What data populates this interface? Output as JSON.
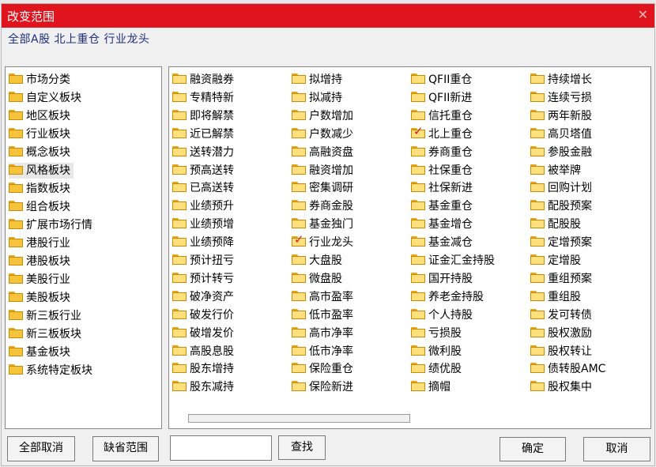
{
  "window": {
    "title": "改变范围",
    "close_symbol": "✕"
  },
  "current_scope": "全部A股 北上重仓 行业龙头",
  "left_list": [
    "市场分类",
    "自定义板块",
    "地区板块",
    "行业板块",
    "概念板块",
    "风格板块",
    "指数板块",
    "组合板块",
    "扩展市场行情",
    "港股行业",
    "港股板块",
    "美股行业",
    "美股板块",
    "新三板行业",
    "新三板板块",
    "基金板块",
    "系统特定板块"
  ],
  "selected_left": "风格板块",
  "grid_columns": [
    [
      "融资融券",
      "专精特新",
      "即将解禁",
      "近已解禁",
      "送转潜力",
      "预高送转",
      "已高送转",
      "业绩预升",
      "业绩预增",
      "业绩预降",
      "预计扭亏",
      "预计转亏",
      "破净资产",
      "破发行价",
      "破增发价",
      "高股息股",
      "股东增持",
      "股东减持"
    ],
    [
      "拟增持",
      "拟减持",
      "户数增加",
      "户数减少",
      "高融资盘",
      "融资增加",
      "密集调研",
      "券商金股",
      "基金独门",
      "行业龙头",
      "大盘股",
      "微盘股",
      "高市盈率",
      "低市盈率",
      "高市净率",
      "低市净率",
      "保险重仓",
      "保险新进"
    ],
    [
      "QFII重仓",
      "QFII新进",
      "信托重仓",
      "北上重仓",
      "券商重仓",
      "社保重仓",
      "社保新进",
      "基金重仓",
      "基金增仓",
      "基金减仓",
      "证金汇金持股",
      "国开持股",
      "养老金持股",
      "个人持股",
      "亏损股",
      "微利股",
      "绩优股",
      "摘帽"
    ],
    [
      "持续增长",
      "连续亏损",
      "两年新股",
      "高贝塔值",
      "参股金融",
      "被举牌",
      "回购计划",
      "配股预案",
      "配股股",
      "定增预案",
      "定增股",
      "重组预案",
      "重组股",
      "发可转债",
      "股权激励",
      "股权转让",
      "债转股AMC",
      "股权集中"
    ]
  ],
  "checked_items": [
    "北上重仓",
    "行业龙头"
  ],
  "buttons": {
    "cancel_all": "全部取消",
    "default_scope": "缺省范围",
    "find": "查找",
    "ok": "确定",
    "cancel": "取消"
  },
  "search": {
    "value": ""
  },
  "colors": {
    "titlebar": "#e0141c",
    "scope_text": "#1e2f7d",
    "folder": "#f5c43a",
    "check": "#e01818"
  }
}
